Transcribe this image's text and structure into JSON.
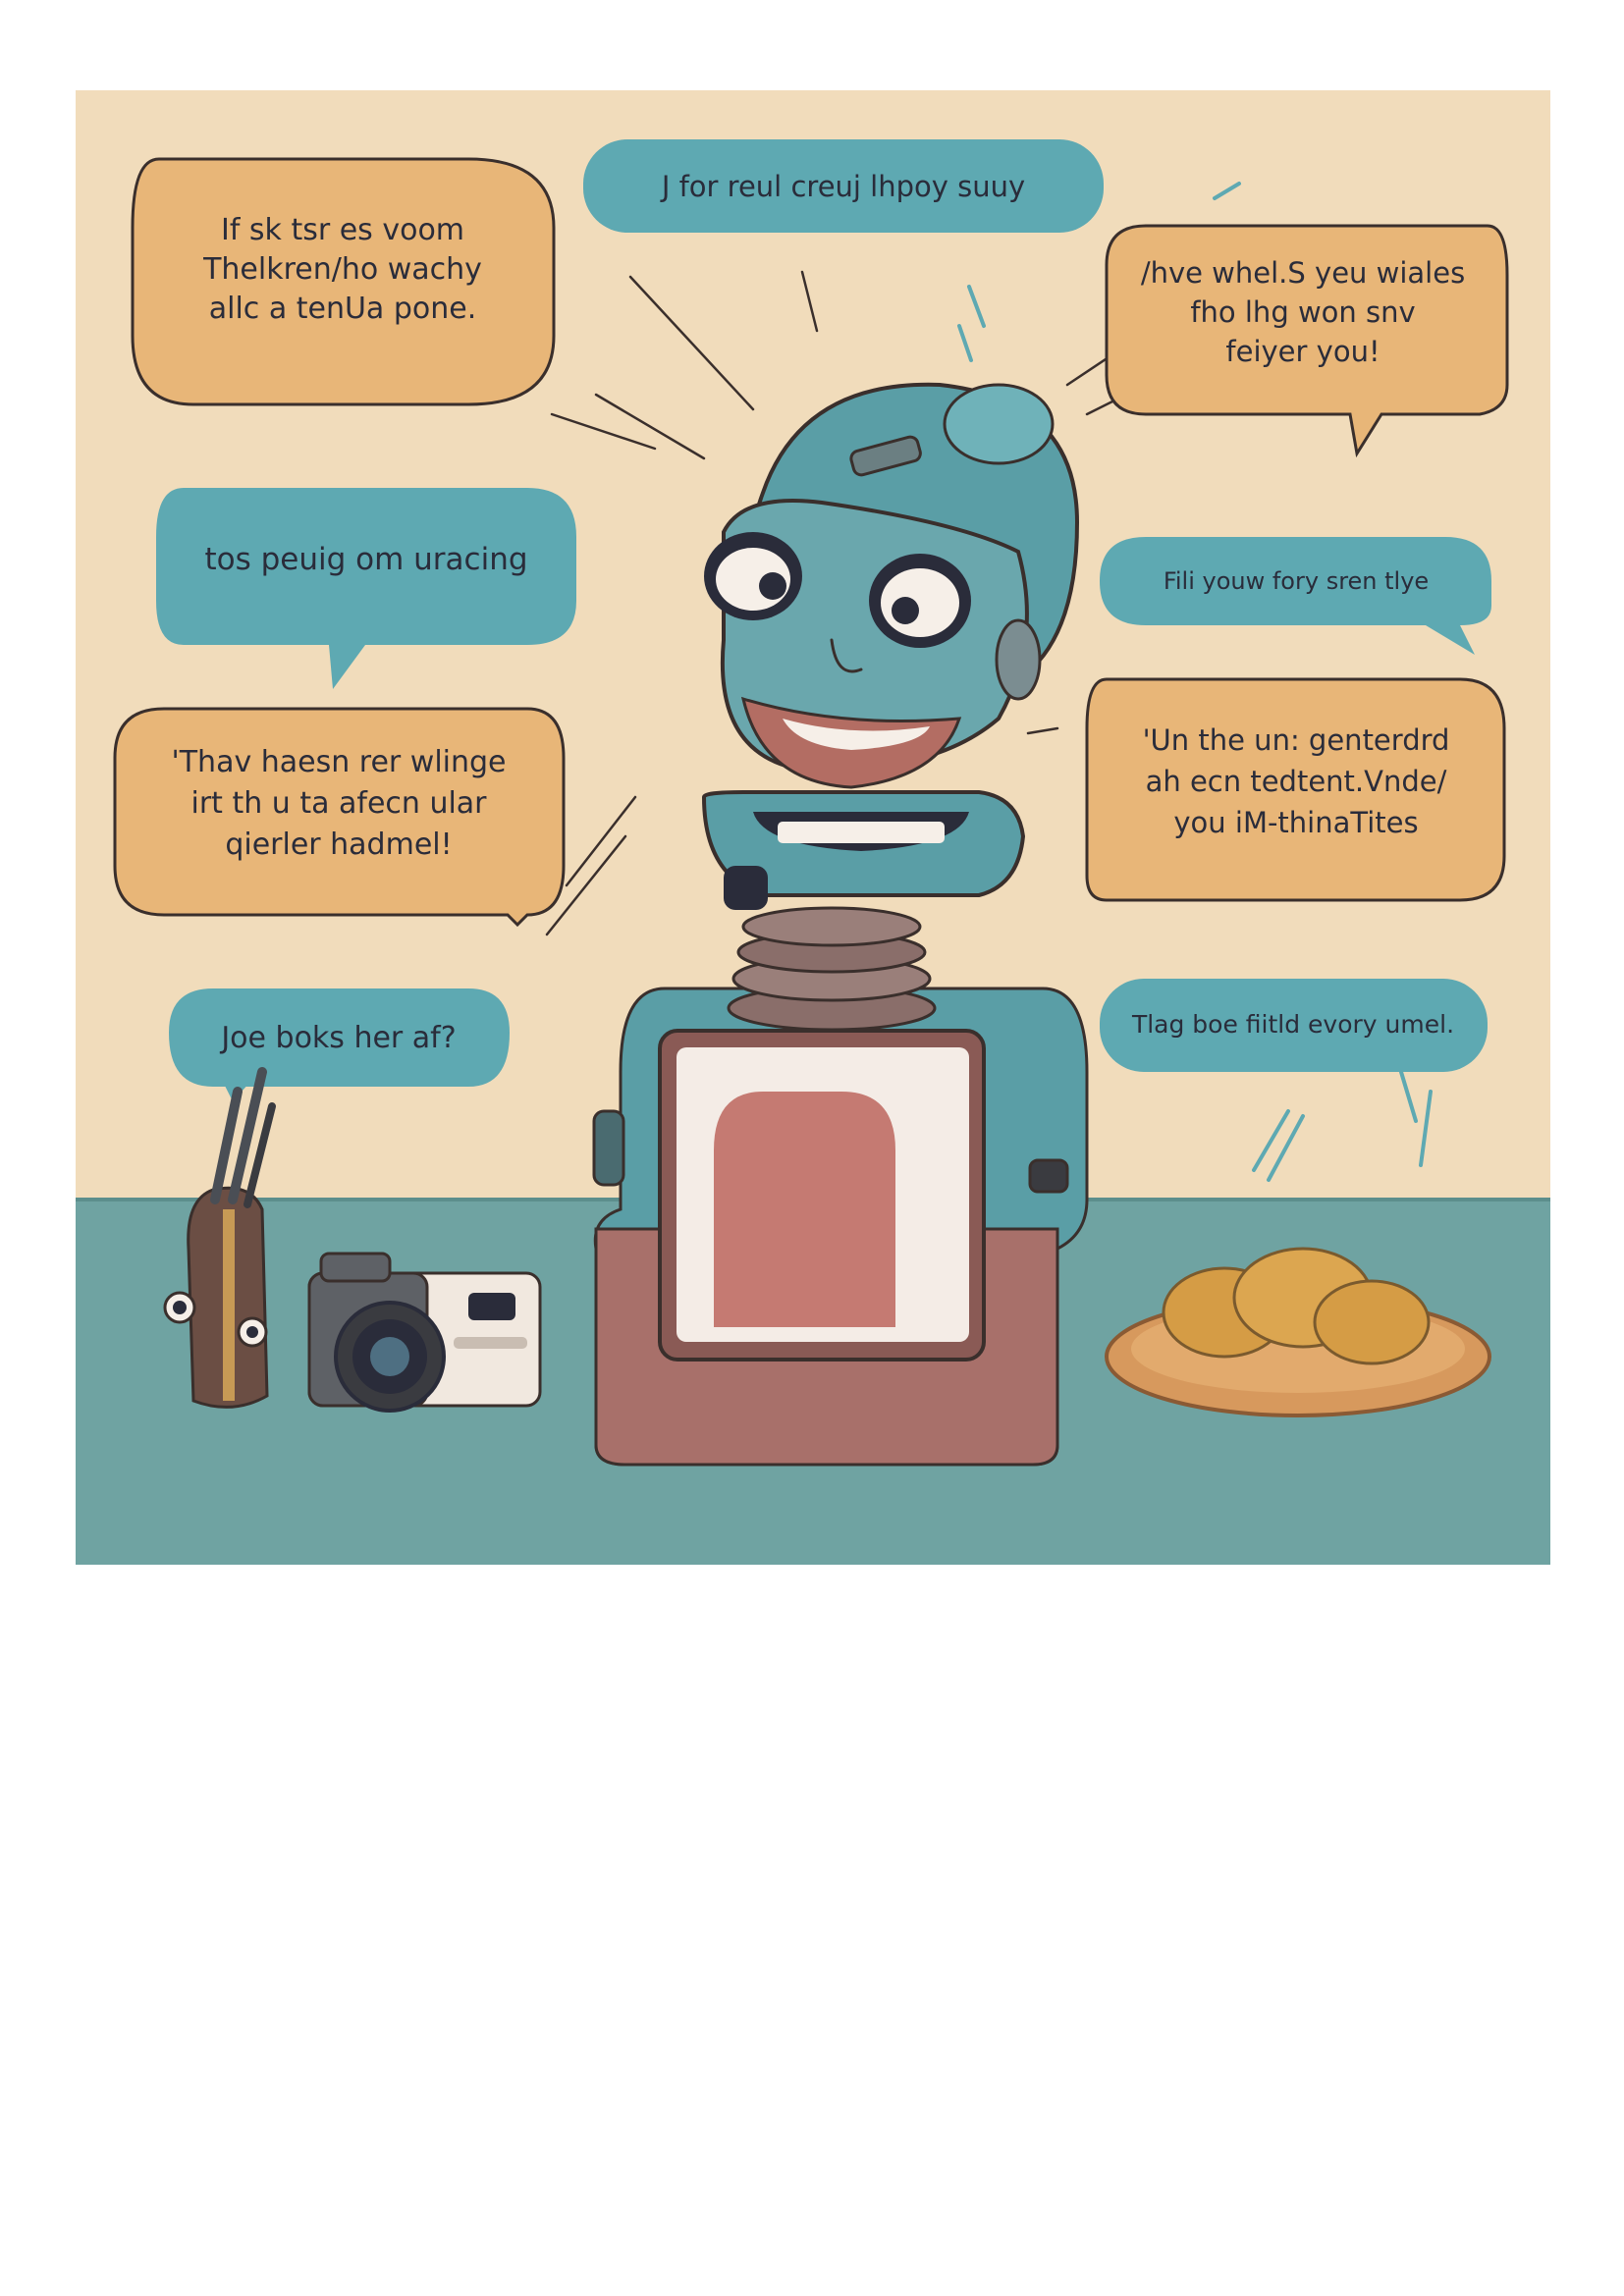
{
  "illustration": {
    "colors": {
      "wall": "#f1dcbb",
      "table": "#6fa3a2",
      "bubble_orange": "#e8b678",
      "bubble_teal": "#5ea9b2",
      "robot_teal": "#5a9ea6",
      "robot_body": "#a8706a",
      "screen": "#c57a72",
      "outline": "#3a2f2c"
    },
    "bubbles": [
      {
        "style": "orange",
        "lines": [
          "If sk tsr es voom",
          "Thelkren/ho wachy",
          "allc a  tenUa pone."
        ]
      },
      {
        "style": "teal",
        "lines": [
          "J for reul creuj lhpoy suuy"
        ]
      },
      {
        "style": "orange",
        "lines": [
          "/hve whel.S yeu wiales",
          "fho lhg won snv",
          "feiyer you!"
        ]
      },
      {
        "style": "teal",
        "lines": [
          "tos peuig om uracing"
        ]
      },
      {
        "style": "teal",
        "lines": [
          "Fili youw fory sren tlye"
        ]
      },
      {
        "style": "orange",
        "lines": [
          "'Thav haesn rer wlinge",
          "irt th u ta afecn ular",
          "qierler hadmel!"
        ]
      },
      {
        "style": "orange",
        "lines": [
          "'Un the un: genterdrd",
          "ah ecn tedtent.Vnde/",
          "you iM-thinaTites"
        ]
      },
      {
        "style": "teal",
        "lines": [
          "Joe boks her af?"
        ]
      },
      {
        "style": "teal",
        "lines": [
          "Tlag boe fiitld evory umel."
        ]
      }
    ],
    "objects": [
      "robot",
      "camera-icon",
      "pen-cup",
      "bread-plate"
    ]
  }
}
